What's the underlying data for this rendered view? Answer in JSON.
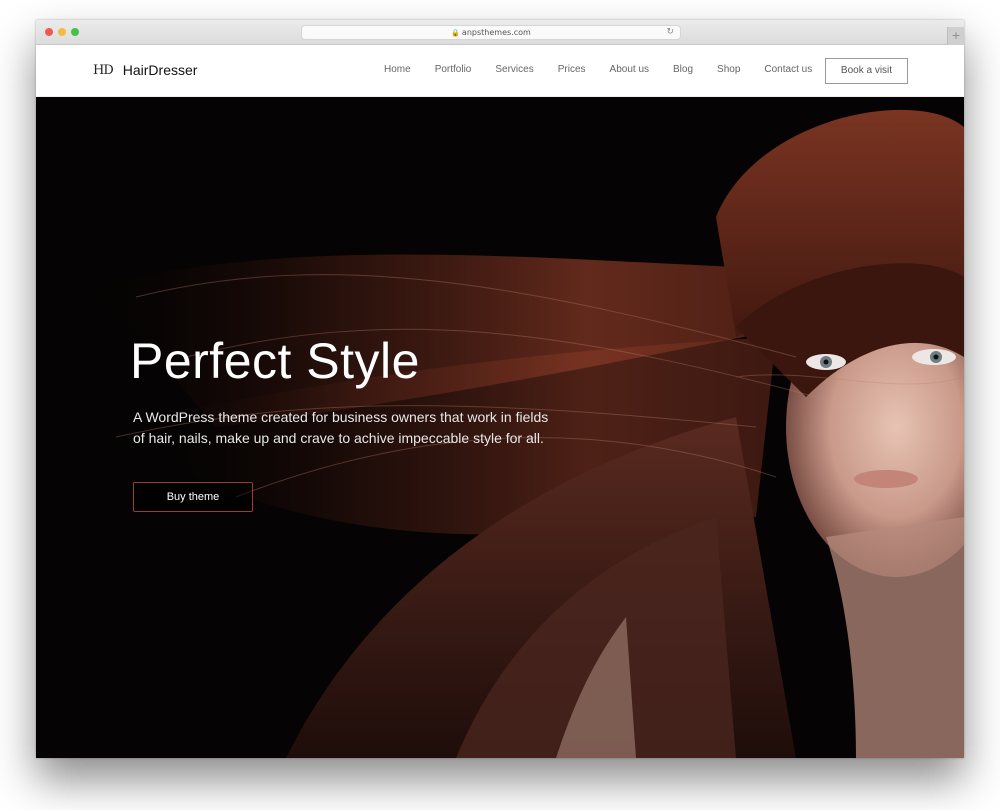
{
  "browser": {
    "url": "anpsthemes.com",
    "lock_icon": "lock-icon",
    "reload_icon": "reload-icon",
    "new_tab_icon": "plus-icon",
    "traffic_colors": {
      "close": "#ee5a52",
      "minimize": "#f4bc3c",
      "maximize": "#45c146"
    }
  },
  "header": {
    "logo_mark": "HD",
    "logo_text": "HairDresser",
    "nav": [
      {
        "label": "Home"
      },
      {
        "label": "Portfolio"
      },
      {
        "label": "Services"
      },
      {
        "label": "Prices"
      },
      {
        "label": "About us"
      },
      {
        "label": "Blog"
      },
      {
        "label": "Shop"
      },
      {
        "label": "Contact us"
      }
    ],
    "cta_label": "Book a visit"
  },
  "hero": {
    "title": "Perfect Style",
    "description": "A WordPress theme created for business owners that work in fields of hair, nails, make up and crave to achive impeccable style for all.",
    "button_label": "Buy theme",
    "accent_color": "#9b3b3b",
    "image_alt": "woman with flowing red-brown hair on black background"
  }
}
